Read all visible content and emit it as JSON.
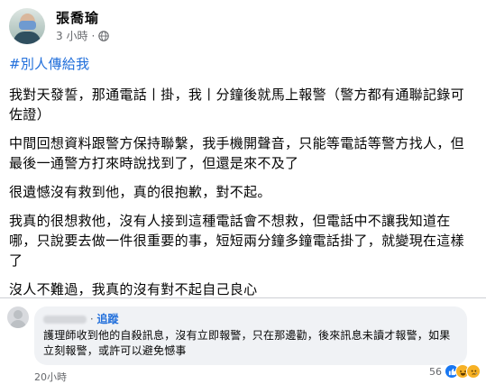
{
  "post": {
    "author": "張喬瑜",
    "time": "3 小時",
    "privacy_icon": "globe-icon",
    "hashtag": "#別人傳給我",
    "paragraphs": [
      "我對天發誓，那通電話丨掛，我丨分鐘後就馬上報警（警方都有通聯記錄可佐證）",
      "中間回想資料跟警方保持聯繫，我手機開聲音，只能等電話等警方找人，但最後一通警方打來時說找到了，但還是來不及了",
      "很遺憾沒有救到他，真的很抱歉，對不起。",
      "我真的很想救他，沒有人接到這種電話會不想救，但電話中不讓我知道在哪，只說要去做一件很重要的事，短短兩分鐘多鐘電話掛了，就變現在這樣了",
      "沒人不難過，我真的沒有對不起自己良心"
    ]
  },
  "comment": {
    "follow_label": "追蹤",
    "separator": "·",
    "text": "護理師收到他的自殺訊息，沒有立即報警，只在那邊勸，後來訊息未讀才報警，如果立刻報警，或許可以避免憾事",
    "time": "20小時",
    "reaction_count": "56",
    "reaction_icons": [
      "like-icon",
      "haha-icon",
      "sad-icon"
    ]
  }
}
